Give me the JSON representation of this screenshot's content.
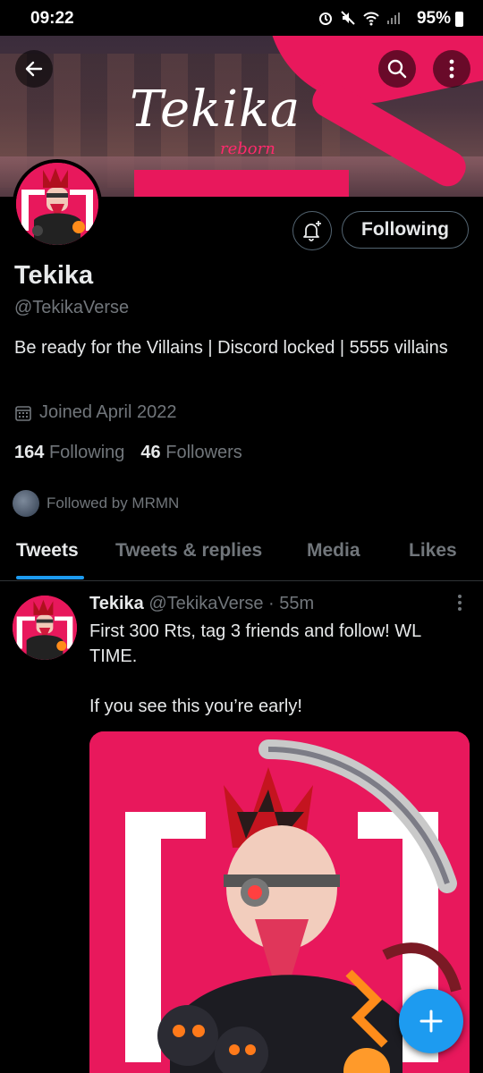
{
  "status_bar": {
    "time": "09:22",
    "battery": "95%"
  },
  "banner": {
    "title": "Tekika",
    "subtitle": "reborn"
  },
  "profile": {
    "name": "Tekika",
    "handle": "@TekikaVerse",
    "following_button": "Following",
    "bio": "Be ready for the Villains | Discord locked | 5555 villains",
    "joined": "Joined April 2022",
    "following_count": "164",
    "following_label": "Following",
    "followers_count": "46",
    "followers_label": "Followers",
    "followed_by": "Followed by MRMN"
  },
  "tabs": [
    {
      "label": "Tweets",
      "active": true
    },
    {
      "label": "Tweets & replies",
      "active": false
    },
    {
      "label": "Media",
      "active": false
    },
    {
      "label": "Likes",
      "active": false
    }
  ],
  "tweet": {
    "author": "Tekika",
    "handle": "@TekikaVerse",
    "separator": "·",
    "time": "55m",
    "text": "First 300 Rts, tag 3 friends and follow! WL TIME.\n\nIf you see this you’re early!"
  },
  "icons": {
    "back": "back-arrow-icon",
    "search": "search-icon",
    "more": "more-vertical-icon",
    "bell": "notification-bell-plus-icon",
    "calendar": "calendar-icon",
    "compose": "plus-icon"
  },
  "colors": {
    "accent": "#1d9bf0",
    "brand": "#e8185c",
    "muted": "#71767b"
  }
}
